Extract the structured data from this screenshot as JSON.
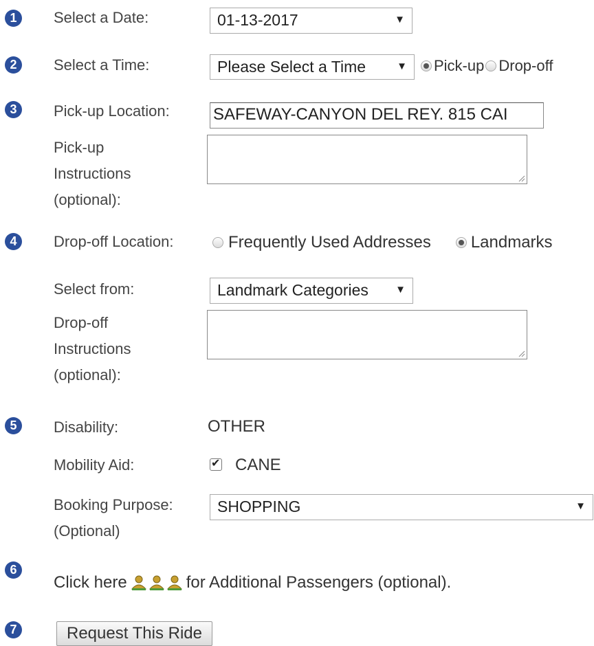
{
  "steps": [
    "1",
    "2",
    "3",
    "4",
    "5",
    "6",
    "7"
  ],
  "date": {
    "label": "Select a Date:",
    "value": "01-13-2017"
  },
  "time": {
    "label": "Select a Time:",
    "value": "Please Select a Time",
    "pickup_label": "Pick-up",
    "dropoff_label": "Drop-off",
    "selected": "Pick-up"
  },
  "pickup": {
    "label": "Pick-up Location:",
    "value": "SAFEWAY-CANYON DEL REY. 815 CAI",
    "instructions_label": [
      "Pick-up",
      "Instructions",
      "(optional):"
    ],
    "instructions_value": ""
  },
  "dropoff": {
    "label": "Drop-off Location:",
    "option_frequent": "Frequently Used Addresses",
    "option_landmarks": "Landmarks",
    "selected": "Landmarks",
    "select_from_label": "Select from:",
    "select_from_value": "Landmark Categories",
    "instructions_label": [
      "Drop-off",
      "Instructions",
      "(optional):"
    ],
    "instructions_value": ""
  },
  "disability": {
    "label": "Disability:",
    "value": "OTHER"
  },
  "mobility": {
    "label": "Mobility Aid:",
    "value": "CANE",
    "checked": true
  },
  "purpose": {
    "label": [
      "Booking Purpose:",
      "(Optional)"
    ],
    "value": "SHOPPING"
  },
  "passengers": {
    "prefix": "Click here",
    "suffix": "for Additional Passengers (optional)."
  },
  "submit": {
    "label": "Request This Ride"
  },
  "colors": {
    "step_badge": "#2b4f9c",
    "passenger_icon": "#c8a030"
  }
}
